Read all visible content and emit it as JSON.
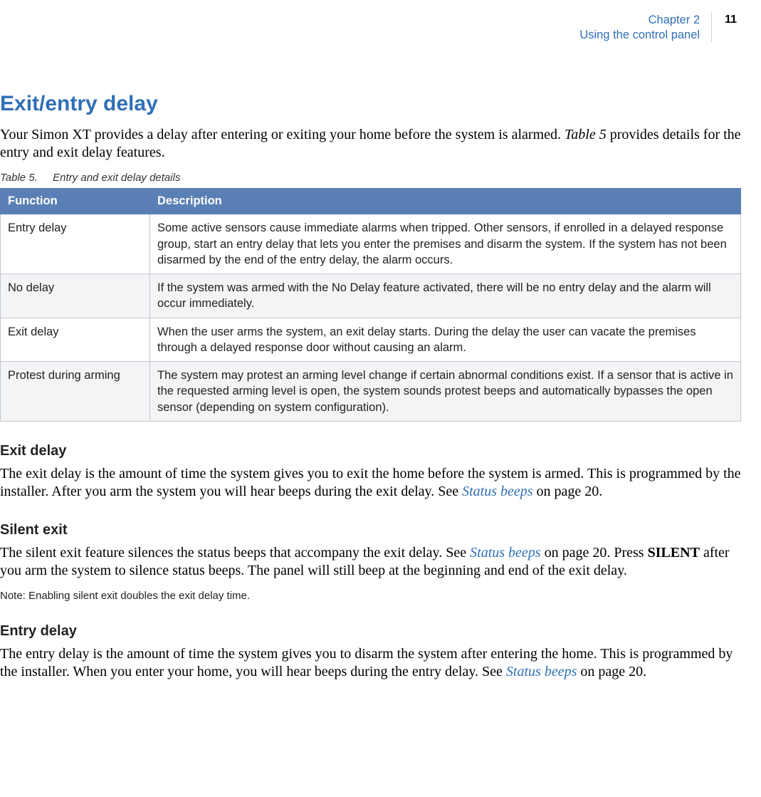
{
  "header": {
    "chapter_line1": "Chapter 2",
    "chapter_line2": "Using the control panel",
    "page_number": "11"
  },
  "h1": "Exit/entry delay",
  "intro_part1": "Your Simon XT provides a delay after entering or exiting your home before the system is alarmed. ",
  "intro_table_ref": "Table 5",
  "intro_part2": " provides details for the entry and exit delay features.",
  "table_caption_label": "Table 5.",
  "table_caption_text": "Entry and exit delay details",
  "table_headers": {
    "c1": "Function",
    "c2": "Description"
  },
  "table_rows": [
    {
      "fn": "Entry delay",
      "desc": "Some active sensors cause immediate alarms when tripped. Other sensors, if enrolled in a delayed response group, start an entry delay that lets you enter the premises and disarm the system. If the system has not been disarmed by the end of the entry delay, the alarm occurs."
    },
    {
      "fn": "No delay",
      "desc": "If the system was armed with the No Delay feature activated, there will be no entry delay and the alarm will occur immediately."
    },
    {
      "fn": "Exit delay",
      "desc": "When the user arms the system, an exit delay starts. During the delay the user can vacate the premises through a delayed response door without causing an alarm."
    },
    {
      "fn": "Protest during arming",
      "desc": "The system may protest an arming level change if certain abnormal conditions exist. If a sensor that is active in the requested arming level is open, the system sounds protest beeps and automatically bypasses the open sensor (depending on system configuration)."
    }
  ],
  "sections": {
    "exit_delay": {
      "heading": "Exit delay",
      "body_part1": "The exit delay is the amount of time the system gives you to exit the home before the system is armed. This is programmed by the installer. After you arm the system you will hear beeps during the exit delay.  See ",
      "link_text": "Status beeps",
      "body_part2": " on page 20."
    },
    "silent_exit": {
      "heading": "Silent exit",
      "body_part1": "The silent exit feature silences the status beeps that accompany the exit delay. See ",
      "link_text": "Status beeps",
      "body_part2": " on page 20. Press ",
      "strong": "SILENT",
      "body_part3": " after you arm the system to silence status beeps. The panel will still beep at the beginning and end of the exit delay.",
      "note_label": "Note:",
      "note_text": "  Enabling silent exit doubles the exit delay time."
    },
    "entry_delay": {
      "heading": "Entry delay",
      "body_part1": "The entry delay is the amount of time the system gives you to disarm the system after entering the home. This is programmed by the installer. When you enter your home, you will hear beeps during the entry delay. See ",
      "link_text": "Status beeps",
      "body_part2": " on page 20."
    }
  }
}
